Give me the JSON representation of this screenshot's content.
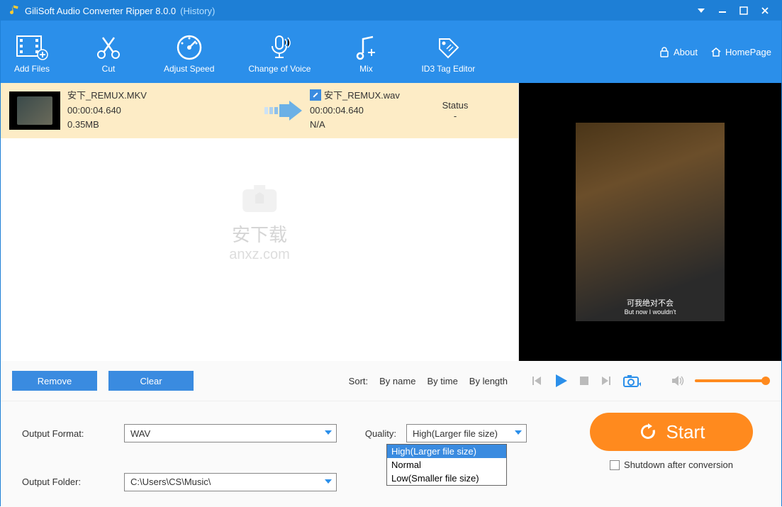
{
  "titlebar": {
    "app_title": "GiliSoft Audio Converter Ripper 8.0.0",
    "history": "(History)"
  },
  "toolbar": {
    "add_files": "Add Files",
    "cut": "Cut",
    "adjust_speed": "Adjust Speed",
    "change_voice": "Change of Voice",
    "mix": "Mix",
    "id3": "ID3 Tag Editor",
    "about": "About",
    "homepage": "HomePage"
  },
  "file": {
    "name": "安下_REMUX.MKV",
    "duration": "00:00:04.640",
    "size": "0.35MB",
    "out_name": "安下_REMUX.wav",
    "out_duration": "00:00:04.640",
    "out_size": "N/A",
    "status_label": "Status",
    "status_value": "-"
  },
  "watermark": {
    "line1": "安下载",
    "line2": "anxz.com"
  },
  "preview": {
    "subtitle1": "可我绝对不会",
    "subtitle2": "But now I wouldn't"
  },
  "buttons": {
    "remove": "Remove",
    "clear": "Clear"
  },
  "sort": {
    "label": "Sort:",
    "by_name": "By name",
    "by_time": "By time",
    "by_length": "By length"
  },
  "form": {
    "output_format_label": "Output Format:",
    "output_format_value": "WAV",
    "quality_label": "Quality:",
    "quality_value": "High(Larger file size)",
    "output_folder_label": "Output Folder:",
    "output_folder_value": "C:\\Users\\CS\\Music\\",
    "quality_options": {
      "high": "High(Larger file size)",
      "normal": "Normal",
      "low": "Low(Smaller file size)"
    }
  },
  "start": {
    "label": "Start",
    "shutdown": "Shutdown after conversion"
  }
}
